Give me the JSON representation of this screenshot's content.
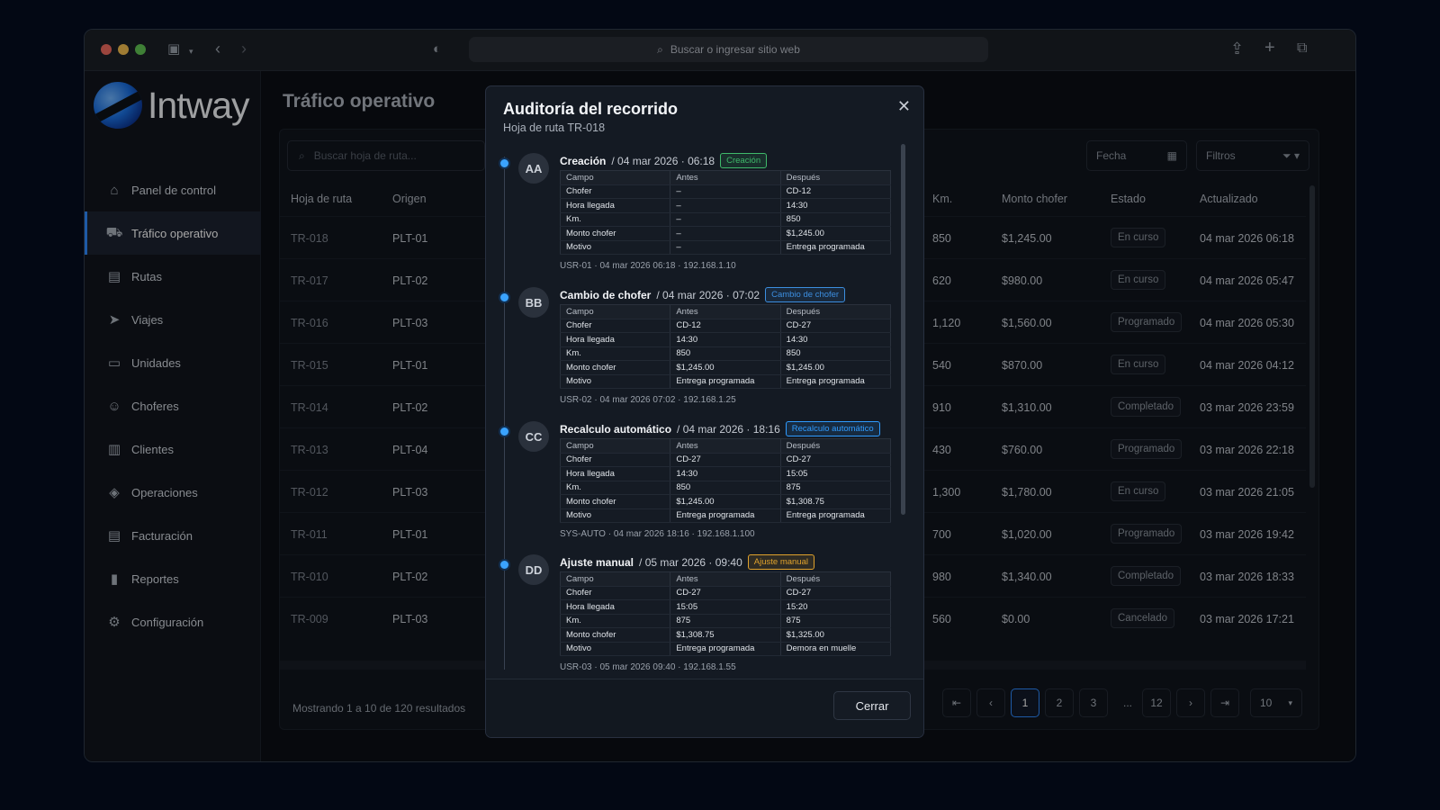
{
  "browser": {
    "url_placeholder": "Buscar o ingresar sitio web"
  },
  "brand": {
    "name": "Intway"
  },
  "sidebar": {
    "items": [
      {
        "label": "Panel de control",
        "icon": "home-icon"
      },
      {
        "label": "Tráfico operativo",
        "icon": "truck-icon",
        "active": true
      },
      {
        "label": "Rutas",
        "icon": "map-icon"
      },
      {
        "label": "Viajes",
        "icon": "send-icon"
      },
      {
        "label": "Unidades",
        "icon": "bus-icon"
      },
      {
        "label": "Choferes",
        "icon": "user-icon"
      },
      {
        "label": "Clientes",
        "icon": "building-icon"
      },
      {
        "label": "Operaciones",
        "icon": "layers-icon"
      },
      {
        "label": "Facturación",
        "icon": "receipt-icon"
      },
      {
        "label": "Reportes",
        "icon": "chart-icon"
      },
      {
        "label": "Configuración",
        "icon": "gear-icon"
      }
    ]
  },
  "main": {
    "title": "Tráfico operativo",
    "search_placeholder": "Buscar hoja de ruta...",
    "date_filter": "Fecha",
    "filters": "Filtros",
    "columns": [
      "Hoja de ruta",
      "Origen",
      "Km.",
      "Monto chofer",
      "Estado",
      "Actualizado"
    ],
    "rows": [
      {
        "id": "TR-018",
        "origen": "PLT-01",
        "km": "850",
        "monto": "$1,245.00",
        "estado": "En curso",
        "actualizado": "04 mar 2026 06:18"
      },
      {
        "id": "TR-017",
        "origen": "PLT-02",
        "km": "620",
        "monto": "$980.00",
        "estado": "En curso",
        "actualizado": "04 mar 2026 05:47"
      },
      {
        "id": "TR-016",
        "origen": "PLT-03",
        "km": "1,120",
        "monto": "$1,560.00",
        "estado": "Programado",
        "actualizado": "04 mar 2026 05:30"
      },
      {
        "id": "TR-015",
        "origen": "PLT-01",
        "km": "540",
        "monto": "$870.00",
        "estado": "En curso",
        "actualizado": "04 mar 2026 04:12"
      },
      {
        "id": "TR-014",
        "origen": "PLT-02",
        "km": "910",
        "monto": "$1,310.00",
        "estado": "Completado",
        "actualizado": "03 mar 2026 23:59"
      },
      {
        "id": "TR-013",
        "origen": "PLT-04",
        "km": "430",
        "monto": "$760.00",
        "estado": "Programado",
        "actualizado": "03 mar 2026 22:18"
      },
      {
        "id": "TR-012",
        "origen": "PLT-03",
        "km": "1,300",
        "monto": "$1,780.00",
        "estado": "En curso",
        "actualizado": "03 mar 2026 21:05"
      },
      {
        "id": "TR-011",
        "origen": "PLT-01",
        "km": "700",
        "monto": "$1,020.00",
        "estado": "Programado",
        "actualizado": "03 mar 2026 19:42"
      },
      {
        "id": "TR-010",
        "origen": "PLT-02",
        "km": "980",
        "monto": "$1,340.00",
        "estado": "Completado",
        "actualizado": "03 mar 2026 18:33"
      },
      {
        "id": "TR-009",
        "origen": "PLT-03",
        "km": "560",
        "monto": "$0.00",
        "estado": "Cancelado",
        "actualizado": "03 mar 2026 17:21"
      }
    ],
    "footer_text": "Mostrando 1 a 10 de 120 resultados",
    "pagination": {
      "pages": [
        "1",
        "2",
        "3",
        "...",
        "12"
      ],
      "current": "1",
      "page_size": "10"
    }
  },
  "modal": {
    "title": "Auditoría del recorrido",
    "subtitle": "Hoja de ruta TR-018",
    "close_label": "Cerrar",
    "table_headers": [
      "Campo",
      "Antes",
      "Después"
    ],
    "events": [
      {
        "avatar": "AA",
        "name": "Creación",
        "datetime": "/ 04 mar 2026 · 06:18",
        "tag": "Creación",
        "tag_color": "#3fb96a",
        "rows": [
          [
            "Chofer",
            "–",
            "CD-12"
          ],
          [
            "Hora llegada",
            "–",
            "14:30"
          ],
          [
            "Km.",
            "–",
            "850"
          ],
          [
            "Monto chofer",
            "–",
            "$1,245.00"
          ],
          [
            "Motivo",
            "–",
            "Entrega programada"
          ]
        ],
        "footer": "USR-01 · 04 mar 2026 06:18 · 192.168.1.10"
      },
      {
        "avatar": "BB",
        "name": "Cambio de chofer",
        "datetime": "/ 04 mar 2026 · 07:02",
        "tag": "Cambio de chofer",
        "tag_color": "#3c8ee0",
        "rows": [
          [
            "Chofer",
            "CD-12",
            "CD-27"
          ],
          [
            "Hora llegada",
            "14:30",
            "14:30"
          ],
          [
            "Km.",
            "850",
            "850"
          ],
          [
            "Monto chofer",
            "$1,245.00",
            "$1,245.00"
          ],
          [
            "Motivo",
            "Entrega programada",
            "Entrega programada"
          ]
        ],
        "footer": "USR-02 · 04 mar 2026 07:02 · 192.168.1.25"
      },
      {
        "avatar": "CC",
        "name": "Recalculo automático",
        "datetime": "/ 04 mar 2026 · 18:16",
        "tag": "Recalculo automático",
        "tag_color": "#2f9bff",
        "rows": [
          [
            "Chofer",
            "CD-27",
            "CD-27"
          ],
          [
            "Hora llegada",
            "14:30",
            "15:05"
          ],
          [
            "Km.",
            "850",
            "875"
          ],
          [
            "Monto chofer",
            "$1,245.00",
            "$1,308.75"
          ],
          [
            "Motivo",
            "Entrega programada",
            "Entrega programada"
          ]
        ],
        "footer": "SYS-AUTO · 04 mar 2026 18:16 · 192.168.1.100"
      },
      {
        "avatar": "DD",
        "name": "Ajuste manual",
        "datetime": "/ 05 mar 2026 · 09:40",
        "tag": "Ajuste manual",
        "tag_color": "#e0a22c",
        "rows": [
          [
            "Chofer",
            "CD-27",
            "CD-27"
          ],
          [
            "Hora llegada",
            "15:05",
            "15:20"
          ],
          [
            "Km.",
            "875",
            "875"
          ],
          [
            "Monto chofer",
            "$1,308.75",
            "$1,325.00"
          ],
          [
            "Motivo",
            "Entrega programada",
            "Demora en muelle"
          ]
        ],
        "footer": "USR-03 · 05 mar 2026 09:40 · 192.168.1.55"
      }
    ]
  }
}
